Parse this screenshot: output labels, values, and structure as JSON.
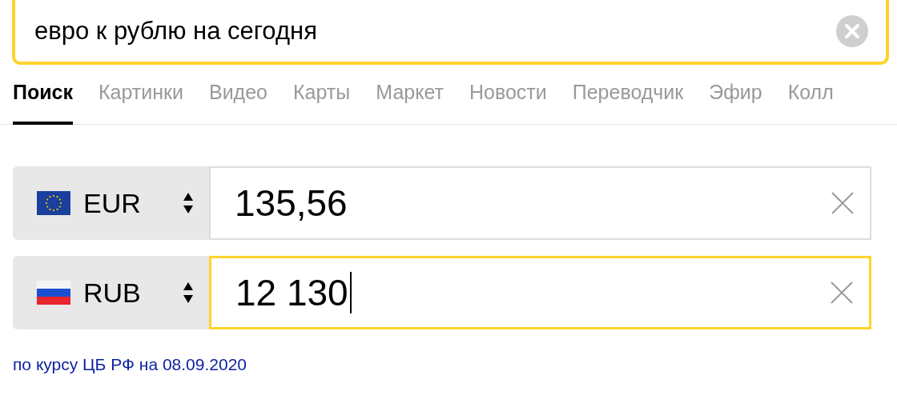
{
  "search": {
    "value": "евро к рублю на сегодня"
  },
  "tabs": [
    {
      "label": "Поиск",
      "selected": true
    },
    {
      "label": "Картинки",
      "selected": false
    },
    {
      "label": "Видео",
      "selected": false
    },
    {
      "label": "Карты",
      "selected": false
    },
    {
      "label": "Маркет",
      "selected": false
    },
    {
      "label": "Новости",
      "selected": false
    },
    {
      "label": "Переводчик",
      "selected": false
    },
    {
      "label": "Эфир",
      "selected": false
    },
    {
      "label": "Колл",
      "selected": false
    }
  ],
  "converter": [
    {
      "code": "EUR",
      "kind": "eu",
      "value": "135,56",
      "focused": false
    },
    {
      "code": "RUB",
      "kind": "ru",
      "value": "12 130",
      "focused": true
    }
  ],
  "rate_note": "по курсу ЦБ РФ на 08.09.2020"
}
